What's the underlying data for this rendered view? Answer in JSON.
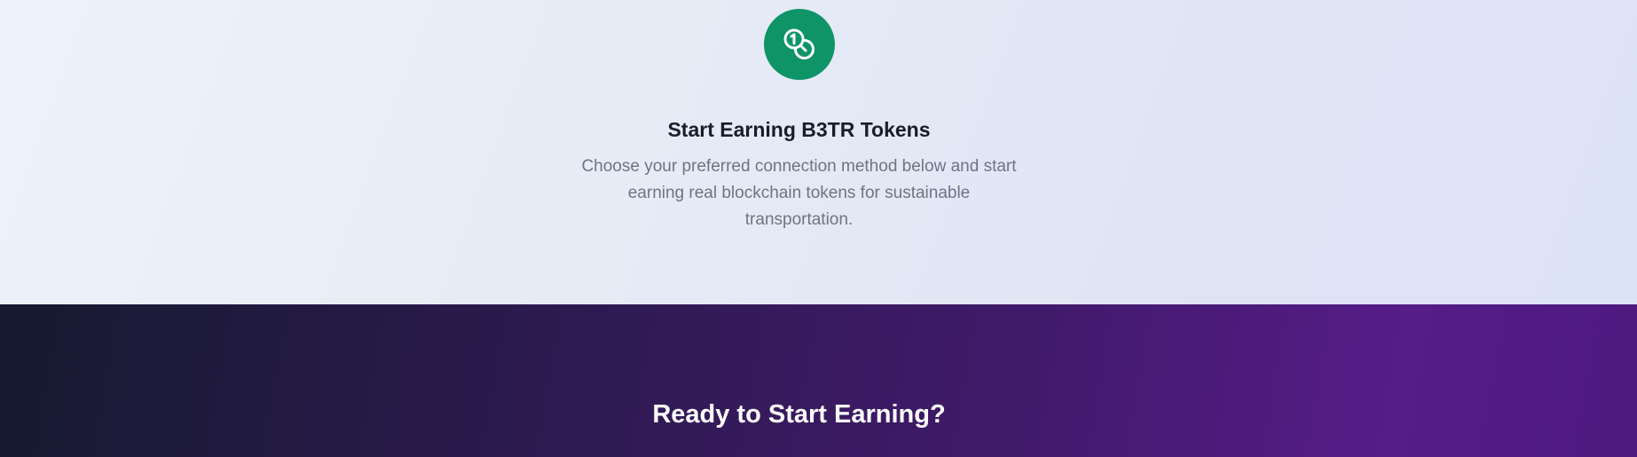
{
  "earning_section": {
    "icon": "coins-icon",
    "icon_color": "#0e9467",
    "title": "Start Earning B3TR Tokens",
    "description": "Choose your preferred connection method below and start earning real blockchain tokens for sustainable transportation."
  },
  "cta_section": {
    "title": "Ready to Start Earning?"
  }
}
